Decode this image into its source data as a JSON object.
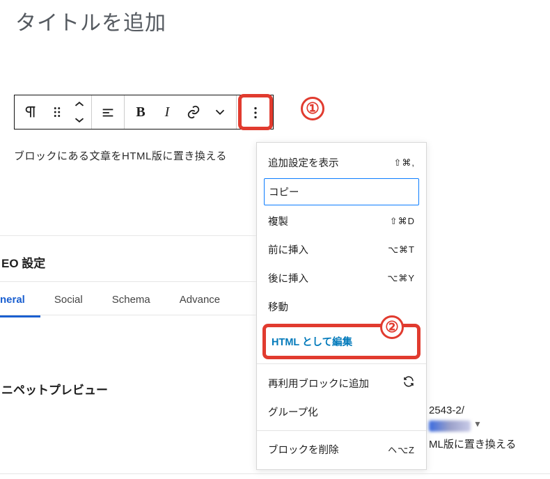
{
  "title_placeholder": "タイトルを追加",
  "content_line": "ブロックにある文章をHTML版に置き換える",
  "annotations": {
    "one": "①",
    "two": "②"
  },
  "menu": {
    "show_settings": {
      "label": "追加設定を表示",
      "shortcut": "⇧⌘,"
    },
    "copy": {
      "label": "コピー"
    },
    "duplicate": {
      "label": "複製",
      "shortcut": "⇧⌘D"
    },
    "insert_before": {
      "label": "前に挿入",
      "shortcut": "⌥⌘T"
    },
    "insert_after": {
      "label": "後に挿入",
      "shortcut": "⌥⌘Y"
    },
    "move": {
      "label": "移動"
    },
    "edit_html": {
      "label": "HTML として編集"
    },
    "add_reusable": {
      "label": "再利用ブロックに追加"
    },
    "group": {
      "label": "グループ化"
    },
    "remove": {
      "label": "ブロックを削除",
      "shortcut": "ヘ⌥Z"
    }
  },
  "seo": {
    "heading": "EO 設定",
    "tabs": {
      "general": "neral",
      "social": "Social",
      "schema": "Schema",
      "advanced": "Advance"
    },
    "snippet_heading": "ニペットプレビュー",
    "snippet_url_frag": "2543-2/",
    "snippet_text_frag": "ML版に置き換える"
  }
}
